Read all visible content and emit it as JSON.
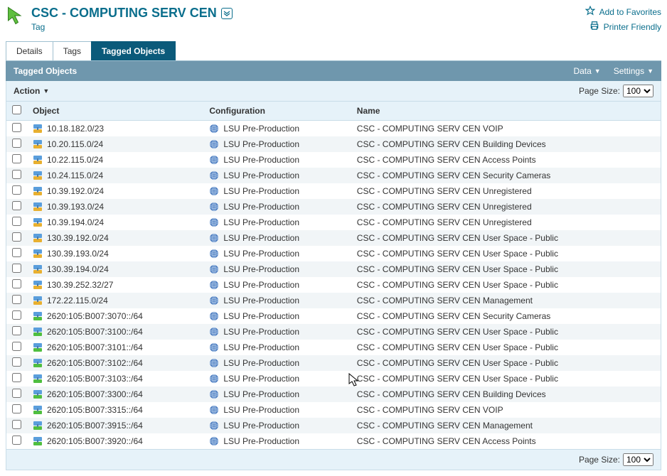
{
  "header": {
    "title": "CSC - COMPUTING SERV CEN",
    "subtitle": "Tag",
    "favorites": "Add to Favorites",
    "printer": "Printer Friendly"
  },
  "tabs": [
    {
      "label": "Details",
      "active": false
    },
    {
      "label": "Tags",
      "active": false
    },
    {
      "label": "Tagged Objects",
      "active": true
    }
  ],
  "panel": {
    "title": "Tagged Objects",
    "data_btn": "Data",
    "settings_btn": "Settings"
  },
  "actionbar": {
    "action": "Action",
    "page_size_label": "Page Size:",
    "page_size_value": "100"
  },
  "columns": {
    "c1": "Object",
    "c2": "Configuration",
    "c3": "Name"
  },
  "rows": [
    {
      "obj": "10.18.182.0/23",
      "cfg": "LSU Pre-Production",
      "name": "CSC - COMPUTING SERV CEN VOIP",
      "v6": false
    },
    {
      "obj": "10.20.115.0/24",
      "cfg": "LSU Pre-Production",
      "name": "CSC - COMPUTING SERV CEN Building Devices",
      "v6": false
    },
    {
      "obj": "10.22.115.0/24",
      "cfg": "LSU Pre-Production",
      "name": "CSC - COMPUTING SERV CEN Access Points",
      "v6": false
    },
    {
      "obj": "10.24.115.0/24",
      "cfg": "LSU Pre-Production",
      "name": "CSC - COMPUTING SERV CEN Security Cameras",
      "v6": false
    },
    {
      "obj": "10.39.192.0/24",
      "cfg": "LSU Pre-Production",
      "name": "CSC - COMPUTING SERV CEN Unregistered",
      "v6": false
    },
    {
      "obj": "10.39.193.0/24",
      "cfg": "LSU Pre-Production",
      "name": "CSC - COMPUTING SERV CEN Unregistered",
      "v6": false
    },
    {
      "obj": "10.39.194.0/24",
      "cfg": "LSU Pre-Production",
      "name": "CSC - COMPUTING SERV CEN Unregistered",
      "v6": false
    },
    {
      "obj": "130.39.192.0/24",
      "cfg": "LSU Pre-Production",
      "name": "CSC - COMPUTING SERV CEN User Space - Public",
      "v6": false
    },
    {
      "obj": "130.39.193.0/24",
      "cfg": "LSU Pre-Production",
      "name": "CSC - COMPUTING SERV CEN User Space - Public",
      "v6": false
    },
    {
      "obj": "130.39.194.0/24",
      "cfg": "LSU Pre-Production",
      "name": "CSC - COMPUTING SERV CEN User Space - Public",
      "v6": false
    },
    {
      "obj": "130.39.252.32/27",
      "cfg": "LSU Pre-Production",
      "name": "CSC - COMPUTING SERV CEN User Space - Public",
      "v6": false
    },
    {
      "obj": "172.22.115.0/24",
      "cfg": "LSU Pre-Production",
      "name": "CSC - COMPUTING SERV CEN Management",
      "v6": false
    },
    {
      "obj": "2620:105:B007:3070::/64",
      "cfg": "LSU Pre-Production",
      "name": "CSC - COMPUTING SERV CEN Security Cameras",
      "v6": true
    },
    {
      "obj": "2620:105:B007:3100::/64",
      "cfg": "LSU Pre-Production",
      "name": "CSC - COMPUTING SERV CEN User Space - Public",
      "v6": true
    },
    {
      "obj": "2620:105:B007:3101::/64",
      "cfg": "LSU Pre-Production",
      "name": "CSC - COMPUTING SERV CEN User Space - Public",
      "v6": true
    },
    {
      "obj": "2620:105:B007:3102::/64",
      "cfg": "LSU Pre-Production",
      "name": "CSC - COMPUTING SERV CEN User Space - Public",
      "v6": true
    },
    {
      "obj": "2620:105:B007:3103::/64",
      "cfg": "LSU Pre-Production",
      "name": "CSC - COMPUTING SERV CEN User Space - Public",
      "v6": true
    },
    {
      "obj": "2620:105:B007:3300::/64",
      "cfg": "LSU Pre-Production",
      "name": "CSC - COMPUTING SERV CEN Building Devices",
      "v6": true
    },
    {
      "obj": "2620:105:B007:3315::/64",
      "cfg": "LSU Pre-Production",
      "name": "CSC - COMPUTING SERV CEN VOIP",
      "v6": true
    },
    {
      "obj": "2620:105:B007:3915::/64",
      "cfg": "LSU Pre-Production",
      "name": "CSC - COMPUTING SERV CEN Management",
      "v6": true
    },
    {
      "obj": "2620:105:B007:3920::/64",
      "cfg": "LSU Pre-Production",
      "name": "CSC - COMPUTING SERV CEN Access Points",
      "v6": true
    }
  ]
}
